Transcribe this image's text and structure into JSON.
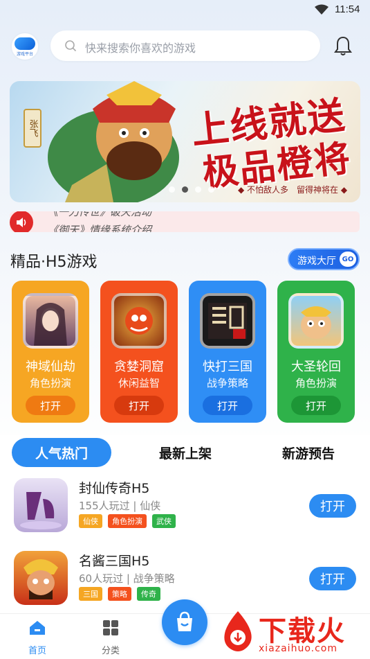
{
  "status_bar": {
    "time": "11:54"
  },
  "header": {
    "logo_text": "游戏平台",
    "search_placeholder": "快来搜索你喜欢的游戏"
  },
  "banner": {
    "hero_name": "张飞",
    "headline_1": "上线就送",
    "headline_2": "极品橙将",
    "slogan": "◆ 不怕敌人多　留得神将在 ◆",
    "dots": 4,
    "active_dot": 1
  },
  "notice": {
    "line_1": "《一刀传世》破天活动",
    "line_2": "《御天》情缘系统介绍"
  },
  "h5_section": {
    "title": "精品·H5游戏",
    "hall_button": "游戏大厅",
    "hall_go": "GO",
    "cards": [
      {
        "title": "神域仙劫",
        "genre": "角色扮演",
        "open": "打开",
        "bg": "#f6a623",
        "btn": "#ef7a12"
      },
      {
        "title": "贪婪洞窟",
        "genre": "休闲益智",
        "open": "打开",
        "bg": "#f4511e",
        "btn": "#d73a0e"
      },
      {
        "title": "快打三国",
        "genre": "战争策略",
        "open": "打开",
        "bg": "#2f8ef5",
        "btn": "#1a6fe0"
      },
      {
        "title": "大圣轮回",
        "genre": "角色扮演",
        "open": "打开",
        "bg": "#2fb24a",
        "btn": "#1d9636"
      }
    ]
  },
  "tabs": [
    {
      "label": "人气热门",
      "active": true
    },
    {
      "label": "最新上架",
      "active": false
    },
    {
      "label": "新游预告",
      "active": false
    }
  ],
  "games": [
    {
      "name": "封仙传奇H5",
      "meta": "155人玩过 | 仙侠",
      "open": "打开",
      "tags": [
        {
          "text": "仙侠",
          "color": "#f5a623"
        },
        {
          "text": "角色扮演",
          "color": "#f4511e"
        },
        {
          "text": "武侠",
          "color": "#2fb24a"
        }
      ]
    },
    {
      "name": "名酱三国H5",
      "meta": "60人玩过 | 战争策略",
      "open": "打开",
      "tags": [
        {
          "text": "三国",
          "color": "#f5a623"
        },
        {
          "text": "策略",
          "color": "#f4511e"
        },
        {
          "text": "传奇",
          "color": "#2fb24a"
        }
      ]
    }
  ],
  "bottom_nav": {
    "home": "首页",
    "category": "分类"
  },
  "watermark": {
    "brand": "下载火",
    "url": "xiazaihuo.com"
  },
  "colors": {
    "accent": "#2c8cf2",
    "notice_red": "#e12a2a",
    "watermark_red": "#e8271c"
  }
}
